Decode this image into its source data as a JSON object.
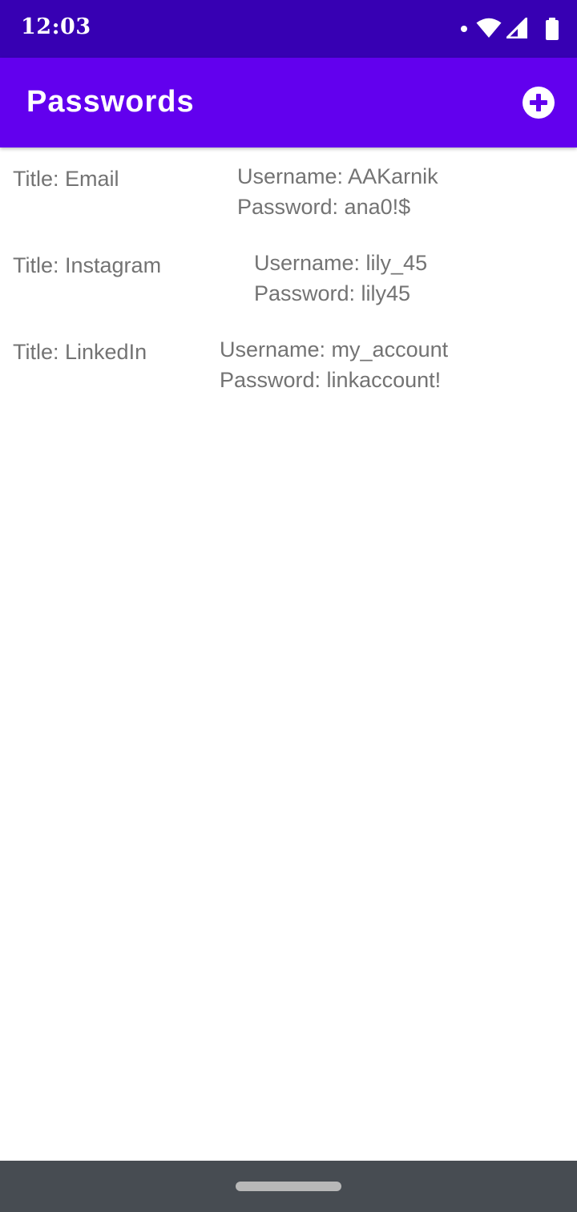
{
  "status_bar": {
    "time": "12:03",
    "icons": [
      "notification-dot-icon",
      "wifi-icon",
      "cell-signal-icon",
      "battery-icon"
    ]
  },
  "app_bar": {
    "title": "Passwords",
    "add_icon": "add-circle-icon",
    "color": "#6200ee"
  },
  "entries": [
    {
      "title": "Title: Email",
      "username": "Username: AAKarnik",
      "password": "Password: ana0!$"
    },
    {
      "title": "Title: Instagram",
      "username": "Username: lily_45",
      "password": "Password: lily45"
    },
    {
      "title": "Title: LinkedIn",
      "username": "Username: my_account",
      "password": "Password: linkaccount!"
    }
  ],
  "colors": {
    "status_bar": "#3700b3",
    "app_bar": "#6200ee",
    "text": "#737373",
    "nav_bar": "#474c52"
  }
}
